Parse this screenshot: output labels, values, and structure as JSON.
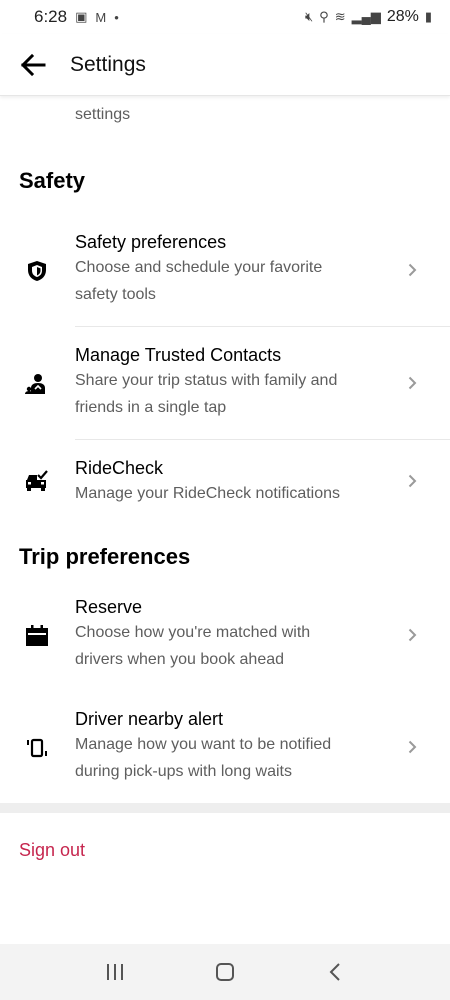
{
  "status_bar": {
    "time": "6:28",
    "battery": "28%"
  },
  "header": {
    "title": "Settings"
  },
  "partial_top_text": "settings",
  "sections": {
    "safety": {
      "title": "Safety",
      "items": [
        {
          "title": "Safety preferences",
          "desc_line1": "Choose and schedule your favorite",
          "desc_line2": "safety tools"
        },
        {
          "title": "Manage Trusted Contacts",
          "desc_line1": "Share your trip status with family and",
          "desc_line2": "friends in a single tap"
        },
        {
          "title": "RideCheck",
          "desc_line1": "Manage your RideCheck notifications",
          "desc_line2": ""
        }
      ]
    },
    "trip": {
      "title": "Trip preferences",
      "items": [
        {
          "title": "Reserve",
          "desc_line1": "Choose how you're matched with",
          "desc_line2": "drivers when you book ahead"
        },
        {
          "title": "Driver nearby alert",
          "desc_line1": "Manage how you want to be notified",
          "desc_line2": "during pick-ups with long waits"
        }
      ]
    }
  },
  "sign_out_label": "Sign out",
  "colors": {
    "sign_out": "#c6264e",
    "secondary_text": "#5e5e5e"
  },
  "icons": {
    "safety_preferences": "shield-icon",
    "trusted_contacts": "contacts-icon",
    "ridecheck": "car-check-icon",
    "reserve": "calendar-icon",
    "driver_nearby": "phone-alert-icon"
  }
}
